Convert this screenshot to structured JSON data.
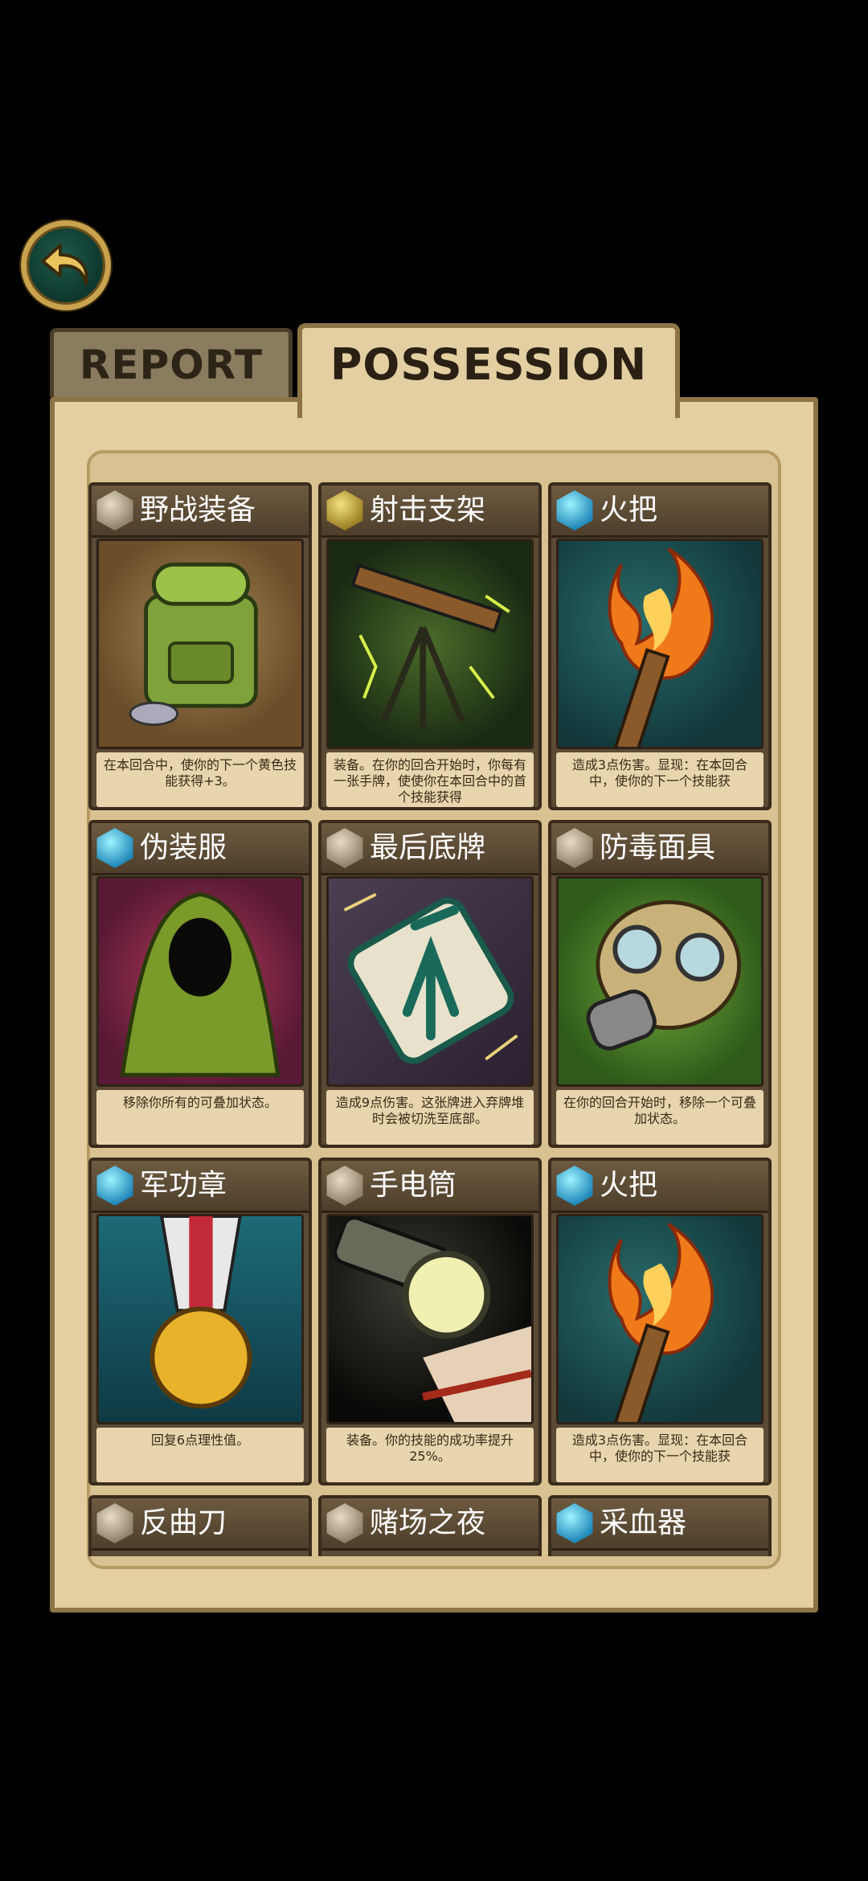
{
  "tabs": {
    "report": "REPORT",
    "possession": "POSSESSION"
  },
  "back_button": {
    "icon": "back-arrow-icon"
  },
  "cards": [
    {
      "title": "野战装备",
      "gem": "neutral",
      "art": "backpack",
      "desc": "在本回合中，使你的下一个黄色技能获得+3。"
    },
    {
      "title": "射击支架",
      "gem": "gold",
      "art": "tripod",
      "desc": "装备。在你的回合开始时，你每有一张手牌，使使你在本回合中的首个技能获得"
    },
    {
      "title": "火把",
      "gem": "blue",
      "art": "torch",
      "desc": "造成3点伤害。显现：在本回合中，使你的下一个技能获"
    },
    {
      "title": "伪装服",
      "gem": "blue",
      "art": "ghillie",
      "desc": "移除你所有的可叠加状态。"
    },
    {
      "title": "最后底牌",
      "gem": "neutral",
      "art": "card",
      "desc": "造成9点伤害。这张牌进入弃牌堆时会被切洗至底部。"
    },
    {
      "title": "防毒面具",
      "gem": "neutral",
      "art": "gasmask",
      "desc": "在你的回合开始时，移除一个可叠加状态。"
    },
    {
      "title": "军功章",
      "gem": "blue",
      "art": "medal",
      "desc": "回复6点理性值。"
    },
    {
      "title": "手电筒",
      "gem": "neutral",
      "art": "flash",
      "desc": "装备。你的技能的成功率提升25%。"
    },
    {
      "title": "火把",
      "gem": "blue",
      "art": "torch",
      "desc": "造成3点伤害。显现：在本回合中，使你的下一个技能获"
    },
    {
      "title": "反曲刀",
      "gem": "neutral",
      "art": "",
      "desc": ""
    },
    {
      "title": "赌场之夜",
      "gem": "neutral",
      "art": "",
      "desc": ""
    },
    {
      "title": "采血器",
      "gem": "blue",
      "art": "",
      "desc": ""
    }
  ]
}
